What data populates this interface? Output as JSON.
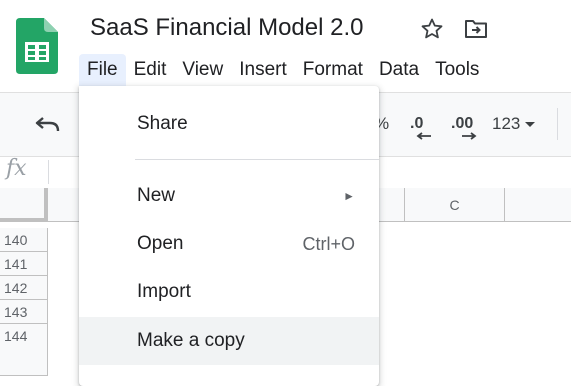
{
  "doc": {
    "title": "SaaS Financial Model 2.0"
  },
  "menubar": [
    "File",
    "Edit",
    "View",
    "Insert",
    "Format",
    "Data",
    "Tools"
  ],
  "toolbar": {
    "percent": "%",
    "decrease_decimal": ".0",
    "increase_decimal": ".00",
    "more_formats": "123"
  },
  "formula_bar": {
    "fx": "fx"
  },
  "grid": {
    "column_c": "C",
    "rows": [
      "140",
      "141",
      "142",
      "143",
      "144"
    ]
  },
  "file_menu": {
    "share": "Share",
    "new": "New",
    "open": "Open",
    "open_shortcut": "Ctrl+O",
    "import": "Import",
    "make_copy": "Make a copy"
  },
  "colors": {
    "sheets_green": "#0f9d58",
    "active_menu_bg": "#e8f0fe",
    "hover_bg": "#f1f3f4"
  }
}
